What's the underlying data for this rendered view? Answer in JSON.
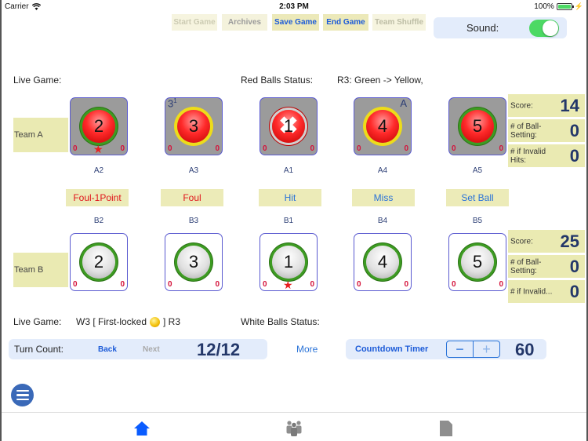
{
  "status_bar": {
    "carrier": "Carrier",
    "time": "2:03 PM",
    "battery": "100%"
  },
  "toolbar": {
    "buttons": [
      {
        "label": "Start Game",
        "state": "disabled"
      },
      {
        "label": "Archives",
        "state": "disabled"
      },
      {
        "label": "Save Game",
        "state": "enabled"
      },
      {
        "label": "End Game",
        "state": "enabled"
      },
      {
        "label": "Team Shuffle",
        "state": "disabled"
      }
    ],
    "sound_label": "Sound:",
    "sound_on": true
  },
  "red_section": {
    "live_game_label": "Live Game:",
    "live_game_value": "",
    "status_label": "Red Balls Status:",
    "status_value": "R3: Green -> Yellow,"
  },
  "team_a": {
    "label": "Team A",
    "balls": [
      {
        "id": "A2",
        "number": "2",
        "ring": "green",
        "left_count": "0",
        "right_count": "0",
        "star": true,
        "badge": "",
        "crossed": false
      },
      {
        "id": "A3",
        "number": "3",
        "ring": "yellow",
        "left_count": "0",
        "right_count": "0",
        "star": false,
        "badge": "3",
        "badge_sup": "1",
        "crossed": false
      },
      {
        "id": "A1",
        "number": "1",
        "ring": "red",
        "left_count": "0",
        "right_count": "0",
        "star": false,
        "badge": "",
        "crossed": true
      },
      {
        "id": "A4",
        "number": "4",
        "ring": "yellow",
        "left_count": "0",
        "right_count": "0",
        "star": false,
        "badge": "A",
        "crossed": false
      },
      {
        "id": "A5",
        "number": "5",
        "ring": "green",
        "left_count": "0",
        "right_count": "0",
        "star": false,
        "badge": "",
        "crossed": false
      }
    ],
    "stats": [
      {
        "label": "Score:",
        "value": "14"
      },
      {
        "label": "# of Ball-Setting:",
        "value": "0"
      },
      {
        "label": "# if Invalid Hits:",
        "value": "0"
      }
    ]
  },
  "actions": [
    {
      "label": "Foul-1Point",
      "color": "red"
    },
    {
      "label": "Foul",
      "color": "red"
    },
    {
      "label": "Hit",
      "color": "blue"
    },
    {
      "label": "Miss",
      "color": "blue"
    },
    {
      "label": "Set Ball",
      "color": "blue"
    }
  ],
  "team_b": {
    "label": "Team B",
    "balls": [
      {
        "id": "B2",
        "number": "2",
        "ring": "green",
        "left_count": "0",
        "right_count": "0",
        "star": false
      },
      {
        "id": "B3",
        "number": "3",
        "ring": "green",
        "left_count": "0",
        "right_count": "0",
        "star": false
      },
      {
        "id": "B1",
        "number": "1",
        "ring": "green",
        "left_count": "0",
        "right_count": "0",
        "star": true
      },
      {
        "id": "B4",
        "number": "4",
        "ring": "green",
        "left_count": "0",
        "right_count": "0",
        "star": false
      },
      {
        "id": "B5",
        "number": "5",
        "ring": "green",
        "left_count": "0",
        "right_count": "0",
        "star": false
      }
    ],
    "stats": [
      {
        "label": "Score:",
        "value": "25"
      },
      {
        "label": "# of Ball-Setting:",
        "value": "0"
      },
      {
        "label": "# if Invalid...",
        "value": "0"
      }
    ]
  },
  "white_section": {
    "live_game_label": "Live Game:",
    "live_game_prefix": "W3 [ First-locked",
    "live_game_suffix": "]  R3",
    "status_label": "White Balls Status:",
    "status_value": ""
  },
  "turn": {
    "label": "Turn Count:",
    "back_label": "Back",
    "next_label": "Next",
    "value": "12/12",
    "more_label": "More"
  },
  "timer": {
    "label": "Countdown Timer",
    "minus": "−",
    "plus": "+",
    "value": "60"
  },
  "tabbar": {
    "tabs": [
      {
        "name": "home",
        "icon": "home-icon",
        "active": true
      },
      {
        "name": "teams",
        "icon": "people-icon",
        "active": false
      },
      {
        "name": "document",
        "icon": "document-icon",
        "active": false
      }
    ]
  },
  "colors": {
    "accent_blue": "#1c5bd8",
    "panel_yellow": "#eaeab2",
    "panel_blue": "#e3ecfb",
    "score_navy": "#233769",
    "foul_red": "#e0151b",
    "toggle_green": "#4cd964"
  }
}
